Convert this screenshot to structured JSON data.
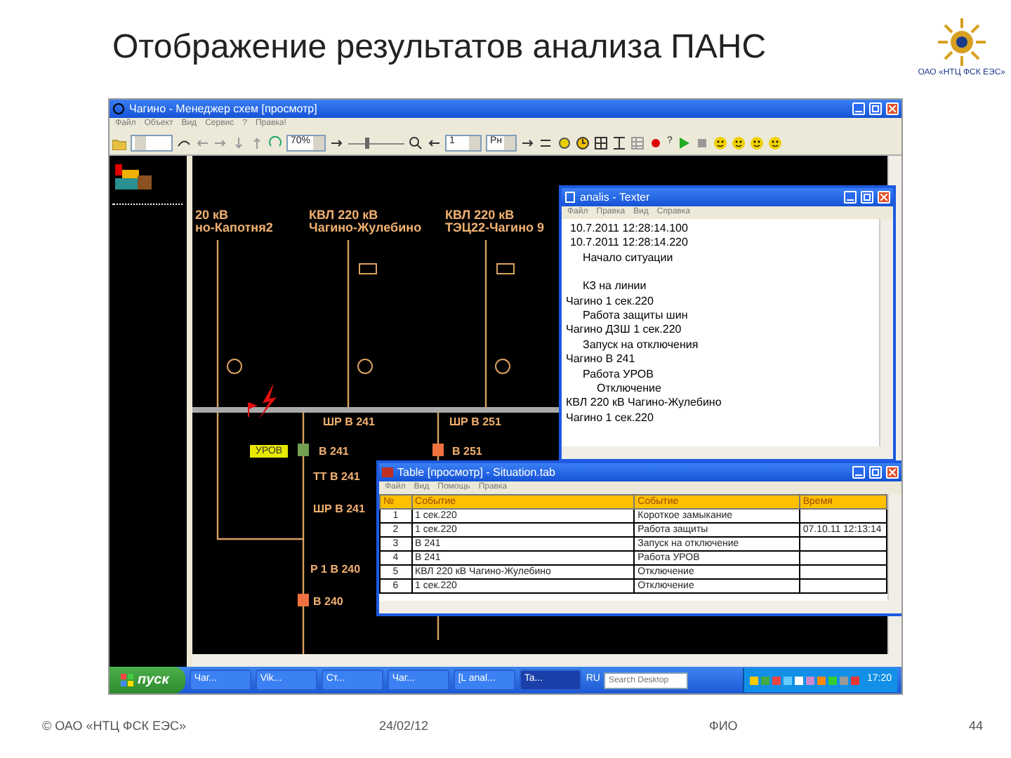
{
  "slide": {
    "title": "Отображение результатов анализа ПАНС",
    "logo_text": "ОАО «НТЦ ФСК ЕЭС»"
  },
  "app": {
    "title": "Чагино - Менеджер схем [просмотр]",
    "menu": [
      "Файл",
      "Объект",
      "Вид",
      "Сервис",
      "?",
      "Правка!"
    ],
    "toolbar": {
      "zoom": "70%",
      "zoom_slider": {
        "level": 0.3
      },
      "page": "1",
      "mode": "Рн",
      "help": "?"
    }
  },
  "diagram": {
    "line_labels": [
      "20 кВ",
      "но-Капотня2",
      "КВЛ 220 кВ",
      "Чагино-Жулебино",
      "КВЛ 220 кВ",
      "ТЭЦ22-Чагино 9"
    ],
    "bay_labels": [
      "ШР В 241",
      "В 241",
      "ТТ В 241",
      "ШР В 241",
      "Р 1 В 240",
      "В 240",
      "ШР В 251",
      "В 251"
    ],
    "alarm_tag": "УРОВ"
  },
  "texter": {
    "title": "analis - Texter",
    "menu": [
      "Файл",
      "Правка",
      "Вид",
      "Справка"
    ],
    "lines": [
      {
        "kind": "stamp",
        "text": "10.7.2011 12:28:14.100"
      },
      {
        "kind": "stamp",
        "text": "10.7.2011 12:28:14.220"
      },
      {
        "kind": "title",
        "text": "Начало ситуации"
      },
      {
        "kind": "event",
        "text": "КЗ на линии"
      },
      {
        "kind": "place",
        "text": "Чагино 1 сек.220"
      },
      {
        "kind": "event",
        "text": "Работа защиты шин"
      },
      {
        "kind": "place",
        "text": "Чагино ДЗШ 1 сек.220"
      },
      {
        "kind": "event",
        "text": "Запуск на отключения"
      },
      {
        "kind": "place",
        "text": "Чагино В 241"
      },
      {
        "kind": "event",
        "text": "Работа УРОВ"
      },
      {
        "kind": "detail",
        "text": "Отключение"
      },
      {
        "kind": "place",
        "text": "КВЛ 220 кВ Чагино-Жулебино"
      },
      {
        "kind": "place",
        "text": "Чагино 1 сек.220"
      }
    ]
  },
  "table_window": {
    "title": "Table [просмотр] - Situation.tab",
    "menu": [
      "Файл",
      "Вид",
      "Помощь",
      "Правка"
    ],
    "columns": [
      "№",
      "Событие",
      "Событие",
      "Время"
    ],
    "rows": [
      {
        "n": "1",
        "object": "1 сек.220",
        "event": "Короткое замыкание"
      },
      {
        "n": "2",
        "object": "1 сек.220",
        "event": "Работа защиты",
        "time": "07.10.11 12:13:14"
      },
      {
        "n": "3",
        "object": "В 241",
        "event": "Запуск на отключение"
      },
      {
        "n": "4",
        "object": "В 241",
        "event": "Работа УРОВ"
      },
      {
        "n": "5",
        "object": "КВЛ 220 кВ Чагино-Жулебино",
        "event": "Отключение"
      },
      {
        "n": "6",
        "object": "1 сек.220",
        "event": "Отключение"
      }
    ]
  },
  "taskbar": {
    "start": "пуск",
    "items": [
      {
        "label": "Чаг...",
        "selected": false
      },
      {
        "label": "Vik...",
        "selected": false
      },
      {
        "label": "Ст...",
        "selected": false
      },
      {
        "label": "Чаг...",
        "selected": false
      },
      {
        "label": "[L anal...",
        "selected": false
      },
      {
        "label": "Ta...",
        "selected": true
      }
    ],
    "language": "RU",
    "search": {
      "placeholder": "Search Desktop"
    },
    "clock": "17:20"
  },
  "footer": {
    "copyright": "© ОАО «НТЦ ФСК ЕЭС»",
    "date": "24/02/12",
    "author": "ФИО",
    "page": "44"
  }
}
